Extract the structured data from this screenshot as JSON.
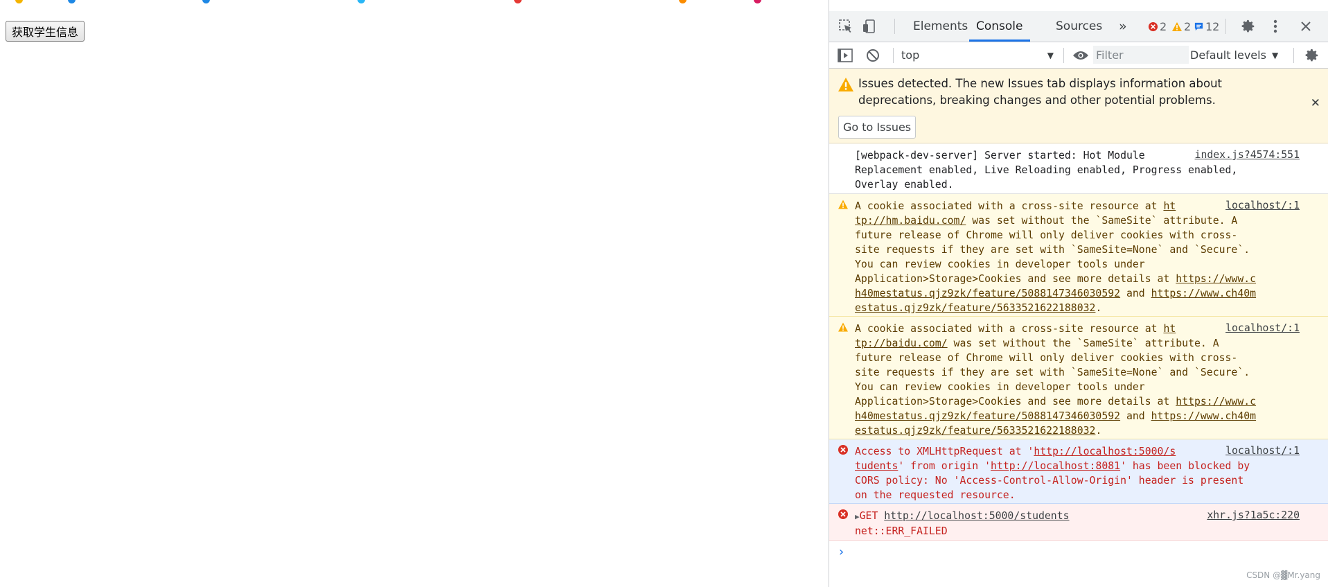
{
  "page": {
    "button_label": "获取学生信息"
  },
  "devtools": {
    "tabs": {
      "elements": "Elements",
      "console": "Console",
      "sources": "Sources"
    },
    "counts": {
      "errors": "2",
      "warnings": "2",
      "messages": "12"
    },
    "toolbar": {
      "context": "top",
      "filter_placeholder": "Filter",
      "levels": "Default levels"
    },
    "banner": {
      "text": "Issues detected. The new Issues tab displays information about deprecations, breaking changes and other potential problems.",
      "button": "Go to Issues"
    },
    "messages": [
      {
        "level": "info",
        "source": "index.js?4574:551",
        "lines": [
          "[webpack-dev-server] Server started: Hot Module",
          "Replacement enabled, Live Reloading enabled, Progress enabled,",
          "Overlay enabled."
        ]
      },
      {
        "level": "warning",
        "source": "localhost/:1",
        "l1a": "A cookie associated with a cross-site resource at ",
        "l1b": "ht",
        "l2a": "tp://hm.baidu.com/",
        "l2b": " was set without the `SameSite` attribute. A",
        "l3": "future release of Chrome will only deliver cookies with cross-",
        "l4": "site requests if they are set with `SameSite=None` and `Secure`.",
        "l5": "You can review cookies in developer tools under",
        "l6a": "Application>Storage>Cookies and see more details at ",
        "l6b": "https://www.c",
        "l7a": "h40mestatus.qjz9zk/feature/5088147346030592",
        "l7b": " and ",
        "l7c": "https://www.ch40m",
        "l8a": "estatus.qjz9zk/feature/5633521622188032",
        "l8b": "."
      },
      {
        "level": "warning",
        "source": "localhost/:1",
        "l1a": "A cookie associated with a cross-site resource at ",
        "l1b": "ht",
        "l2a": "tp://baidu.com/",
        "l2b": " was set without the `SameSite` attribute. A",
        "l3": "future release of Chrome will only deliver cookies with cross-",
        "l4": "site requests if they are set with `SameSite=None` and `Secure`.",
        "l5": "You can review cookies in developer tools under",
        "l6a": "Application>Storage>Cookies and see more details at ",
        "l6b": "https://www.c",
        "l7a": "h40mestatus.qjz9zk/feature/5088147346030592",
        "l7b": " and ",
        "l7c": "https://www.ch40m",
        "l8a": "estatus.qjz9zk/feature/5633521622188032",
        "l8b": "."
      },
      {
        "level": "error",
        "source": "localhost/:1",
        "l1a": "Access to XMLHttpRequest at '",
        "l1b": "http://localhost:5000/s",
        "l2a": "tudents",
        "l2b": "' from origin '",
        "l2c": "http://localhost:8081",
        "l2d": "' has been blocked by",
        "l3": "CORS policy: No 'Access-Control-Allow-Origin' header is present",
        "l4": "on the requested resource."
      },
      {
        "level": "error",
        "source": "xhr.js?1a5c:220",
        "method": "GET ",
        "url": "http://localhost:5000/students",
        "l2": "net::ERR_FAILED"
      }
    ],
    "prompt": "›",
    "watermark": "CSDN @▓Mr.yang"
  }
}
